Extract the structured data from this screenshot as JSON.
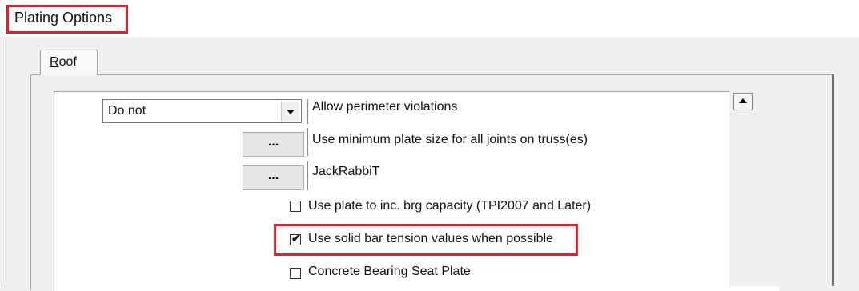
{
  "window": {
    "title": "Plating Options"
  },
  "tabs": [
    {
      "label": "Roof",
      "active": true
    }
  ],
  "options": {
    "perimeter": {
      "select_value": "Do not",
      "label": "Allow perimeter violations"
    },
    "min_plate": {
      "button_label": "...",
      "label": "Use minimum plate size for all joints on truss(es)"
    },
    "jackrabbit": {
      "button_label": "...",
      "label": "JackRabbiT"
    },
    "brg_capacity": {
      "label": "Use plate to inc. brg capacity (TPI2007 and Later)",
      "checked": false
    },
    "solid_bar": {
      "label": "Use solid bar tension values when possible",
      "checked": true,
      "checkmark": "✔"
    },
    "concrete": {
      "label": "Concrete Bearing Seat Plate",
      "checked": false
    }
  },
  "colors": {
    "highlight": "#e0202c",
    "panel": "#ffffff",
    "dialog": "#f0f0f0"
  }
}
